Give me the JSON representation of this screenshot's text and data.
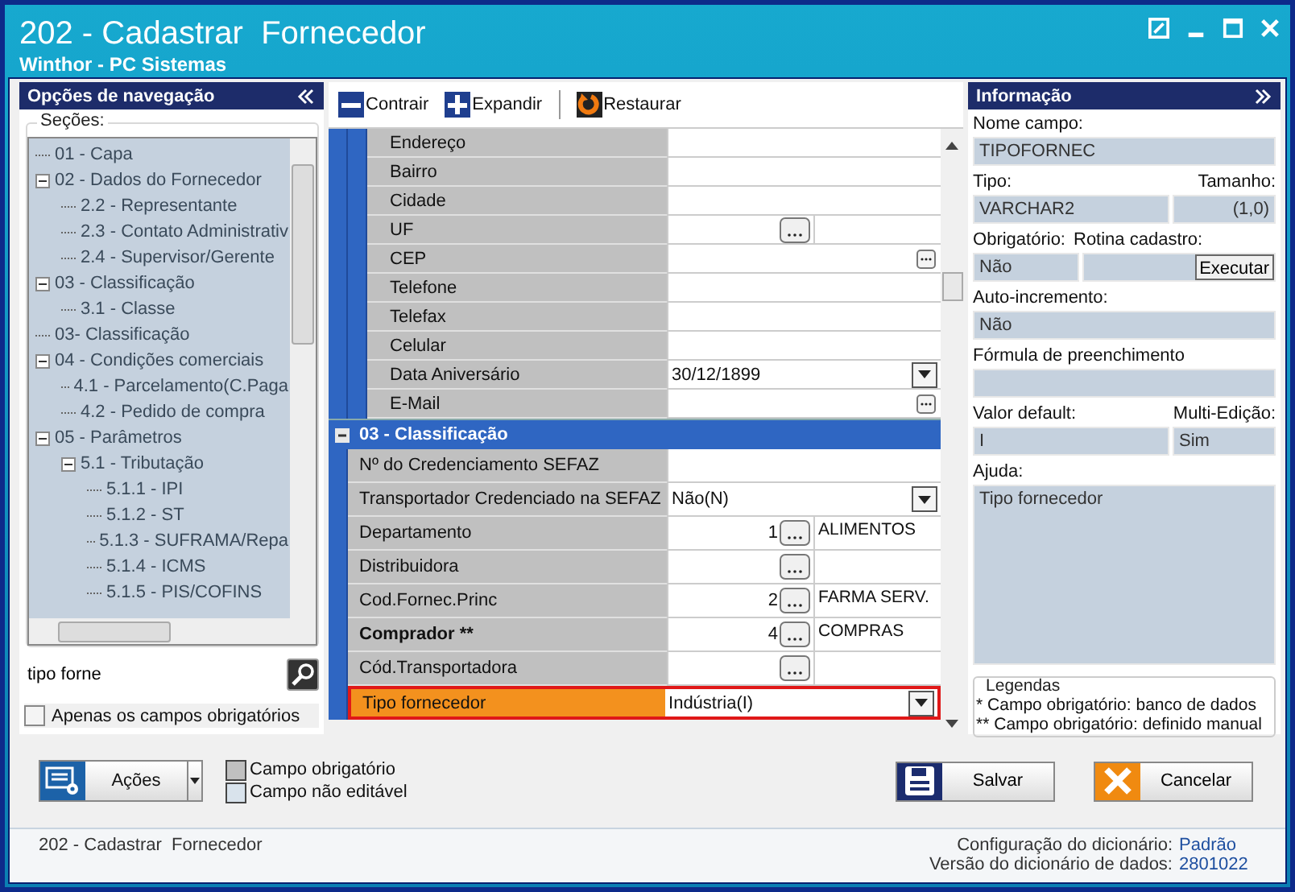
{
  "window": {
    "title": "202 - Cadastrar  Fornecedor",
    "subtitle": "Winthor - PC Sistemas"
  },
  "navigation": {
    "title": "Opções de navegação",
    "group_label": "Seções:",
    "tree": [
      {
        "label": "01 - Capa"
      },
      {
        "label": "02 - Dados do Fornecedor",
        "expanded": true,
        "children": [
          {
            "label": "2.2 - Representante"
          },
          {
            "label": "2.3 - Contato Administrativ"
          },
          {
            "label": "2.4 - Supervisor/Gerente"
          }
        ]
      },
      {
        "label": "03 - Classificação",
        "expanded": true,
        "children": [
          {
            "label": "3.1 - Classe"
          }
        ]
      },
      {
        "label": "03- Classificação"
      },
      {
        "label": "04 - Condições comerciais",
        "expanded": true,
        "children": [
          {
            "label": "4.1 - Parcelamento(C.Paga"
          },
          {
            "label": "4.2 - Pedido de compra"
          }
        ]
      },
      {
        "label": "05 - Parâmetros",
        "expanded": true,
        "children": [
          {
            "label": "5.1 - Tributação",
            "expanded": true,
            "children": [
              {
                "label": "5.1.1 - IPI"
              },
              {
                "label": "5.1.2 - ST"
              },
              {
                "label": "5.1.3 - SUFRAMA/Repa"
              },
              {
                "label": "5.1.4 - ICMS"
              },
              {
                "label": "5.1.5 - PIS/COFINS"
              }
            ]
          }
        ]
      }
    ],
    "search": {
      "value": "tipo forne"
    },
    "required_only": {
      "label": "Apenas os campos obrigatórios",
      "checked": false
    }
  },
  "toolbar": [
    {
      "label": "Contrair",
      "kind": "collapse"
    },
    {
      "label": "Expandir",
      "kind": "expand"
    },
    {
      "label": "Restaurar",
      "kind": "restore"
    }
  ],
  "form": {
    "groups": [
      {
        "kind": "nested",
        "rows": [
          {
            "label": "Endereço",
            "kind": "text",
            "selected": false,
            "mandatory": false
          },
          {
            "label": "Bairro",
            "kind": "text",
            "selected": false,
            "mandatory": false
          },
          {
            "label": "Cidade",
            "kind": "text",
            "selected": false,
            "mandatory": false
          },
          {
            "label": "UF",
            "kind": "lookup",
            "selected": false,
            "mandatory": false
          },
          {
            "label": "CEP",
            "kind": "ellipsis",
            "selected": false,
            "mandatory": false
          },
          {
            "label": "Telefone",
            "kind": "text",
            "selected": false,
            "mandatory": false
          },
          {
            "label": "Telefax",
            "kind": "text",
            "selected": false,
            "mandatory": false
          },
          {
            "label": "Celular",
            "kind": "text",
            "selected": false,
            "mandatory": false
          },
          {
            "label": "Data Aniversário",
            "kind": "dropdown",
            "value": "30/12/1899",
            "selected": false,
            "mandatory": false
          },
          {
            "label": "E-Mail",
            "kind": "ellipsis",
            "selected": false,
            "mandatory": false
          }
        ]
      },
      {
        "kind": "section",
        "title": "03 - Classificação",
        "expanded": true,
        "rows": [
          {
            "label": "Nº do Credenciamento SEFAZ",
            "kind": "text",
            "selected": false,
            "mandatory": false
          },
          {
            "label": "Transportador Credenciado na SEFAZ",
            "kind": "dropdown",
            "value": "Não(N)",
            "selected": false,
            "mandatory": false
          },
          {
            "label": "Departamento",
            "kind": "lookup",
            "code": "1",
            "description": "ALIMENTOS",
            "selected": false,
            "mandatory": false
          },
          {
            "label": "Distribuidora",
            "kind": "lookup",
            "selected": false,
            "mandatory": false
          },
          {
            "label": "Cod.Fornec.Princ",
            "kind": "lookup",
            "code": "2",
            "description": "FARMA SERV.",
            "selected": false,
            "mandatory": false
          },
          {
            "label": "Comprador **",
            "kind": "lookup",
            "code": "4",
            "description": "COMPRAS",
            "selected": false,
            "mandatory": true
          },
          {
            "label": "Cód.Transportadora",
            "kind": "lookup",
            "selected": false,
            "mandatory": false
          },
          {
            "label": "Tipo fornecedor",
            "kind": "dropdown",
            "value": "Indústria(I)",
            "selected": true,
            "mandatory": false
          }
        ]
      }
    ]
  },
  "info": {
    "title": "Informação",
    "field_name": {
      "label": "Nome campo:",
      "value": "TIPOFORNEC"
    },
    "type": {
      "label": "Tipo:",
      "value": "VARCHAR2"
    },
    "size": {
      "label": "Tamanho:",
      "value": "(1,0)"
    },
    "required": {
      "label": "Obrigatório:",
      "value": "Não"
    },
    "routine": {
      "label": "Rotina cadastro:",
      "button": "Executar"
    },
    "auto_increment": {
      "label": "Auto-incremento:",
      "value": "Não"
    },
    "formula": {
      "label": "Fórmula de preenchimento"
    },
    "default_value": {
      "label": "Valor default:",
      "value": "I"
    },
    "multi_edit": {
      "label": "Multi-Edição:",
      "value": "Sim"
    },
    "help": {
      "label": "Ajuda:",
      "value": "Tipo fornecedor"
    },
    "legend": {
      "title": "Legendas",
      "lines": [
        "* Campo obrigatório: banco de dados",
        "** Campo obrigatório: definido manual"
      ]
    }
  },
  "actions": {
    "label": "Ações"
  },
  "swatches": [
    {
      "label": "Campo obrigatório",
      "color": "#c0c0c0"
    },
    {
      "label": "Campo não editável",
      "color": "#d9e3ec"
    }
  ],
  "buttons": [
    {
      "label": "Salvar",
      "kind": "save"
    },
    {
      "label": "Cancelar",
      "kind": "cancel"
    }
  ],
  "status": {
    "text": "202 - Cadastrar  Fornecedor",
    "lines": [
      {
        "label": "Configuração do dicionário:",
        "value": "Padrão"
      },
      {
        "label": "Versão do dicionário de dados:",
        "value": "2801022"
      }
    ]
  }
}
